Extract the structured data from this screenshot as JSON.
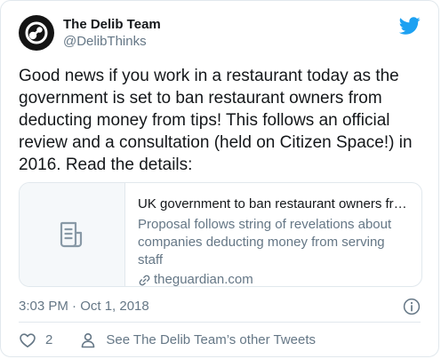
{
  "tweet": {
    "author": {
      "display_name": "The Delib Team",
      "handle": "@DelibThinks"
    },
    "text": "Good news if you work in a restaurant today as the government is set to ban restaurant owners from deducting money from tips! This follows an official review and a consultation (held on Citizen Space!) in 2016. Read the details:",
    "link_card": {
      "title": "UK government to ban restaurant owners fro...",
      "description": "Proposal follows string of revelations about companies deducting money from serving staff",
      "domain": "theguardian.com"
    },
    "timestamp": "3:03 PM · Oct 1, 2018",
    "like_count": "2",
    "profile_link_label": "See The Delib Team’s other Tweets"
  },
  "colors": {
    "twitter_blue": "#1da1f2",
    "text_primary": "#14171a",
    "text_secondary": "#657786",
    "border": "#e1e8ed",
    "avatar_bg": "#141414"
  },
  "icons": {
    "avatar": "delib-logo-icon",
    "brand": "twitter-bird-icon",
    "link_thumbnail": "document-icon",
    "domain": "link-icon",
    "info": "info-icon",
    "like": "heart-icon",
    "profile": "person-icon"
  }
}
